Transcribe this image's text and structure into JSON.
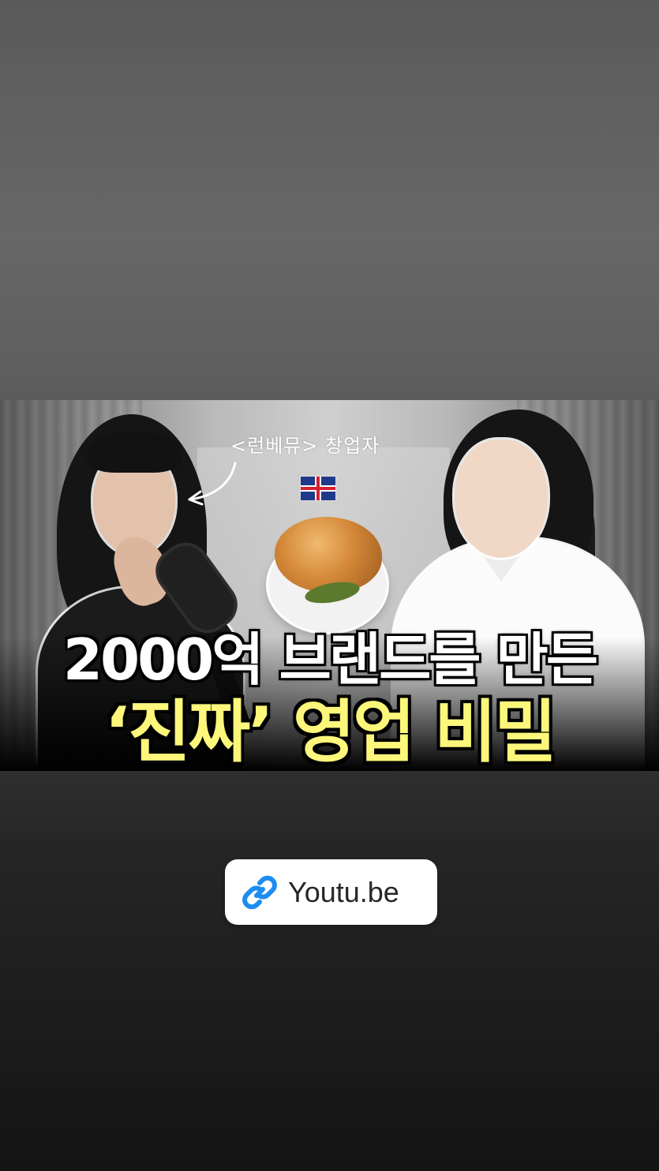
{
  "thumbnail": {
    "annotation": "<런베뮤> 창업자",
    "headline_line1": "2000억 브랜드를 만든",
    "headline_line2": "‘진짜’ 영업 비밀",
    "headline_line1_color": "#ffffff",
    "headline_line2_color": "#fcf67a"
  },
  "link_sticker": {
    "label": "Youtu.be",
    "icon": "link-icon",
    "icon_color": "#1e8cf0"
  }
}
